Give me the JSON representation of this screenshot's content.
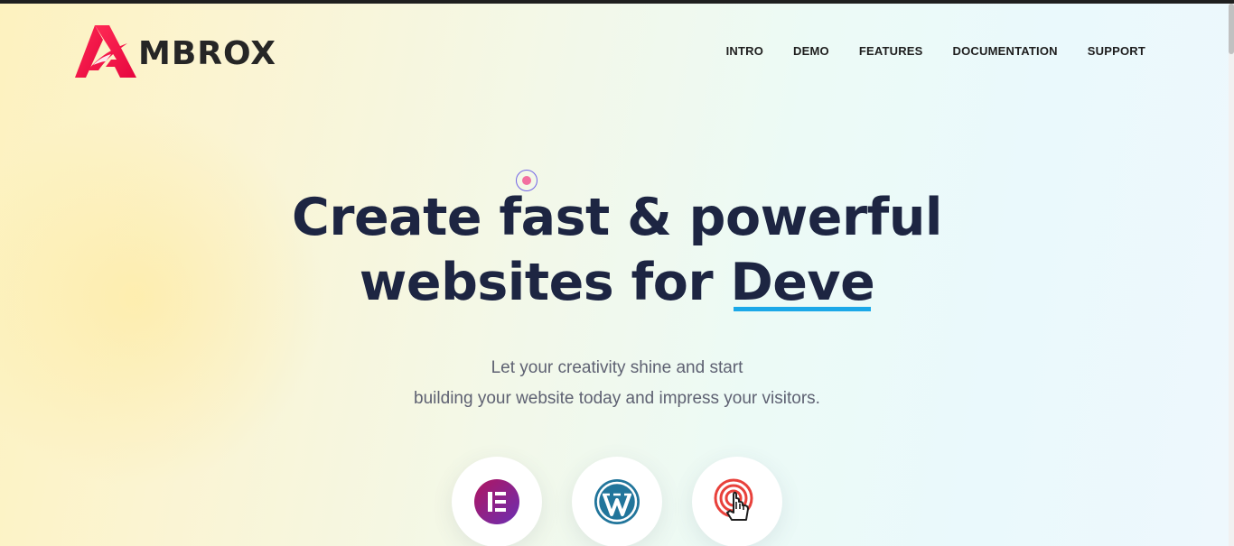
{
  "brand": {
    "name": "MBROX",
    "logo_color": "#f0164d"
  },
  "nav": {
    "items": [
      {
        "label": "INTRO"
      },
      {
        "label": "DEMO"
      },
      {
        "label": "FEATURES"
      },
      {
        "label": "DOCUMENTATION"
      },
      {
        "label": "SUPPORT"
      }
    ]
  },
  "hero": {
    "title_line1": "Create fast & powerful",
    "title_line2_prefix": "websites for ",
    "title_typed": "Deve",
    "subtitle_line1": "Let your creativity shine and start",
    "subtitle_line2": "building your website today and impress your visitors."
  },
  "platforms": [
    {
      "icon": "elementor-icon",
      "color": "#92003b"
    },
    {
      "icon": "wordpress-icon",
      "color": "#21759b"
    },
    {
      "icon": "touch-click-icon",
      "color": "#e8413b"
    }
  ],
  "colors": {
    "title": "#1d2542",
    "subtitle": "#5e6172",
    "typed_underline": "#1ba8e8"
  }
}
